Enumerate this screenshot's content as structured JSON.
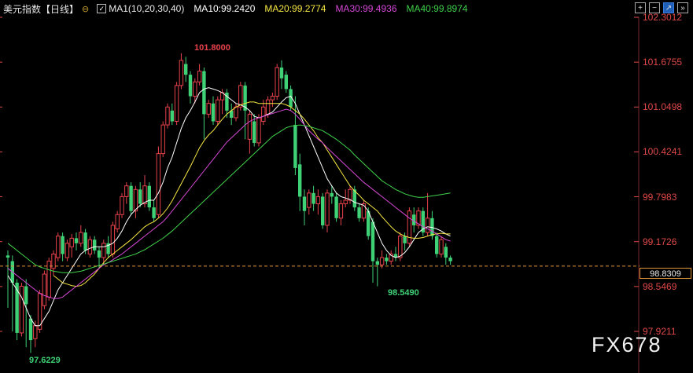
{
  "header": {
    "title": "美元指数",
    "period": "【日线】",
    "toggle_icon": "collapse-toggle-icon",
    "ma_checkbox_label": "MA1(10,20,30,40)",
    "ma": [
      {
        "label": "MA10:99.2420",
        "color": "#ffffff"
      },
      {
        "label": "MA20:99.2774",
        "color": "#f5e642"
      },
      {
        "label": "MA30:99.4936",
        "color": "#d648d6"
      },
      {
        "label": "MA40:99.8974",
        "color": "#3fd14a"
      }
    ],
    "tools": [
      {
        "icon": "add-icon",
        "glyph": "+"
      },
      {
        "icon": "minus-icon",
        "glyph": "−"
      },
      {
        "icon": "draw-icon",
        "glyph": "↗"
      },
      {
        "icon": "collapse-icon",
        "glyph": "»"
      }
    ]
  },
  "colors": {
    "up": "#e8424c",
    "down": "#3fd176",
    "ma10": "#ffffff",
    "ma20": "#f5e642",
    "ma30": "#d648d6",
    "ma40": "#3fd14a",
    "price_line": "#e0953a"
  },
  "price_axis": [
    "102.3012",
    "101.6755",
    "101.0498",
    "100.4241",
    "99.7983",
    "99.1726",
    "98.5469",
    "97.9211"
  ],
  "current_price": "98.8309",
  "annotations": {
    "high": "101.8000",
    "low": "97.6229",
    "recent_low": "98.5490"
  },
  "watermark": "FX678",
  "chart_data": {
    "type": "candlestick",
    "ylim": [
      97.9211,
      102.3012
    ],
    "candles": [
      [
        98.98,
        98.95,
        99.05,
        98.25
      ],
      [
        98.9,
        98.6,
        98.98,
        97.92
      ],
      [
        98.6,
        97.9,
        98.65,
        97.8
      ],
      [
        97.9,
        98.55,
        98.6,
        97.85
      ],
      [
        98.55,
        98.3,
        98.65,
        97.7
      ],
      [
        98.1,
        97.8,
        98.15,
        97.62
      ],
      [
        97.82,
        98.0,
        98.07,
        97.7
      ],
      [
        97.95,
        98.45,
        98.5,
        97.9
      ],
      [
        98.28,
        98.72,
        98.77,
        98.23
      ],
      [
        98.4,
        98.9,
        98.95,
        98.35
      ],
      [
        98.8,
        99.0,
        99.05,
        98.7
      ],
      [
        98.95,
        99.25,
        99.3,
        98.9
      ],
      [
        99.25,
        99.0,
        99.3,
        98.9
      ],
      [
        98.95,
        99.15,
        99.2,
        98.9
      ],
      [
        99.1,
        99.22,
        99.28,
        98.95
      ],
      [
        99.22,
        99.15,
        99.3,
        99.05
      ],
      [
        99.15,
        99.3,
        99.4,
        99.1
      ],
      [
        99.3,
        99.05,
        99.35,
        99.0
      ],
      [
        99.0,
        99.2,
        99.25,
        98.95
      ],
      [
        99.2,
        99.05,
        99.25,
        99.0
      ],
      [
        99.05,
        98.95,
        99.1,
        98.8
      ],
      [
        98.95,
        99.15,
        99.2,
        98.85
      ],
      [
        99.15,
        99.0,
        99.25,
        98.95
      ],
      [
        99.0,
        99.4,
        99.45,
        98.95
      ],
      [
        99.35,
        99.55,
        99.6,
        99.3
      ],
      [
        99.55,
        99.8,
        99.85,
        99.5
      ],
      [
        99.8,
        99.95,
        100.0,
        99.7
      ],
      [
        99.95,
        99.6,
        100.0,
        99.55
      ],
      [
        99.6,
        99.9,
        99.95,
        99.5
      ],
      [
        99.9,
        99.7,
        100.0,
        99.65
      ],
      [
        99.7,
        99.95,
        100.1,
        99.65
      ],
      [
        99.95,
        99.65,
        100.0,
        99.6
      ],
      [
        99.65,
        99.5,
        99.75,
        99.45
      ],
      [
        99.55,
        100.4,
        100.5,
        99.5
      ],
      [
        100.4,
        100.8,
        100.85,
        100.35
      ],
      [
        100.8,
        101.05,
        101.1,
        100.75
      ],
      [
        101.0,
        100.85,
        101.1,
        100.8
      ],
      [
        100.85,
        101.35,
        101.4,
        100.8
      ],
      [
        101.35,
        101.7,
        101.8,
        101.3
      ],
      [
        101.65,
        101.5,
        101.75,
        101.4
      ],
      [
        101.5,
        101.2,
        101.55,
        101.1
      ],
      [
        101.2,
        101.4,
        101.45,
        101.1
      ],
      [
        101.4,
        101.55,
        101.65,
        101.35
      ],
      [
        101.55,
        100.95,
        101.6,
        100.6
      ],
      [
        100.95,
        101.1,
        101.15,
        100.9
      ],
      [
        101.1,
        100.85,
        101.2,
        100.8
      ],
      [
        100.85,
        101.15,
        101.2,
        100.8
      ],
      [
        101.15,
        101.25,
        101.3,
        100.95
      ],
      [
        101.25,
        101.0,
        101.3,
        100.9
      ],
      [
        101.0,
        100.9,
        101.1,
        100.8
      ],
      [
        100.9,
        101.05,
        101.1,
        100.85
      ],
      [
        101.05,
        101.35,
        101.4,
        101.0
      ],
      [
        101.35,
        101.0,
        101.4,
        100.6
      ],
      [
        100.6,
        100.95,
        101.0,
        100.4
      ],
      [
        100.85,
        100.55,
        100.95,
        100.5
      ],
      [
        100.55,
        100.9,
        100.95,
        100.5
      ],
      [
        100.85,
        101.05,
        101.15,
        100.8
      ],
      [
        100.95,
        101.15,
        101.2,
        100.9
      ],
      [
        101.15,
        101.2,
        101.25,
        101.05
      ],
      [
        101.2,
        101.6,
        101.65,
        101.15
      ],
      [
        101.6,
        101.45,
        101.7,
        101.3
      ],
      [
        101.5,
        101.3,
        101.55,
        101.25
      ],
      [
        101.3,
        101.05,
        101.35,
        101.0
      ],
      [
        100.8,
        100.2,
        101.2,
        100.1
      ],
      [
        100.25,
        99.8,
        100.4,
        99.6
      ],
      [
        99.8,
        99.6,
        99.9,
        99.4
      ],
      [
        99.65,
        99.85,
        99.9,
        99.55
      ],
      [
        99.85,
        99.7,
        99.95,
        99.6
      ],
      [
        99.7,
        99.8,
        99.9,
        99.55
      ],
      [
        99.8,
        99.4,
        99.85,
        99.35
      ],
      [
        99.4,
        99.85,
        99.9,
        99.3
      ],
      [
        99.85,
        99.8,
        99.95,
        99.7
      ],
      [
        99.8,
        99.5,
        99.85,
        99.45
      ],
      [
        99.5,
        99.7,
        99.75,
        99.4
      ],
      [
        99.7,
        99.75,
        99.9,
        99.65
      ],
      [
        99.75,
        99.9,
        99.95,
        99.7
      ],
      [
        99.9,
        99.65,
        99.95,
        99.6
      ],
      [
        99.65,
        99.5,
        99.7,
        99.45
      ],
      [
        99.5,
        99.7,
        99.75,
        99.45
      ],
      [
        99.6,
        99.25,
        99.65,
        99.2
      ],
      [
        99.45,
        98.9,
        99.5,
        98.6
      ],
      [
        98.9,
        98.85,
        98.95,
        98.55
      ],
      [
        98.85,
        98.95,
        99.05,
        98.8
      ],
      [
        98.95,
        98.9,
        99.0,
        98.85
      ],
      [
        98.9,
        99.0,
        99.05,
        98.85
      ],
      [
        99.0,
        98.95,
        99.1,
        98.9
      ],
      [
        98.95,
        99.25,
        99.3,
        98.9
      ],
      [
        99.25,
        99.15,
        99.3,
        99.05
      ],
      [
        99.15,
        99.6,
        99.65,
        99.1
      ],
      [
        99.55,
        99.4,
        99.65,
        99.3
      ],
      [
        99.4,
        99.6,
        99.65,
        99.35
      ],
      [
        99.6,
        99.3,
        99.65,
        99.25
      ],
      [
        99.3,
        99.5,
        99.85,
        99.25
      ],
      [
        99.5,
        99.25,
        99.6,
        99.2
      ],
      [
        99.25,
        99.0,
        99.3,
        98.95
      ],
      [
        99.0,
        99.2,
        99.25,
        98.95
      ],
      [
        99.1,
        98.95,
        99.15,
        98.85
      ],
      [
        98.95,
        98.9,
        98.98,
        98.85
      ]
    ],
    "series": [
      {
        "name": "MA10",
        "values": [
          98.7,
          98.6,
          98.5,
          98.4,
          98.25,
          98.1,
          98.0,
          98.0,
          98.1,
          98.2,
          98.35,
          98.5,
          98.6,
          98.7,
          98.8,
          98.9,
          99.0,
          99.05,
          99.08,
          99.1,
          99.1,
          99.1,
          99.12,
          99.15,
          99.22,
          99.32,
          99.45,
          99.55,
          99.62,
          99.68,
          99.72,
          99.75,
          99.75,
          99.85,
          100.0,
          100.2,
          100.35,
          100.55,
          100.75,
          100.9,
          101.0,
          101.12,
          101.25,
          101.3,
          101.32,
          101.3,
          101.28,
          101.25,
          101.2,
          101.15,
          101.1,
          101.08,
          101.05,
          101.0,
          100.92,
          100.9,
          100.92,
          100.95,
          100.98,
          101.05,
          101.12,
          101.18,
          101.2,
          101.1,
          100.95,
          100.8,
          100.65,
          100.5,
          100.35,
          100.2,
          100.05,
          99.95,
          99.85,
          99.8,
          99.78,
          99.76,
          99.72,
          99.7,
          99.68,
          99.6,
          99.45,
          99.3,
          99.15,
          99.05,
          98.98,
          98.95,
          98.97,
          99.02,
          99.1,
          99.2,
          99.3,
          99.35,
          99.38,
          99.37,
          99.35,
          99.32,
          99.28,
          99.25
        ]
      },
      {
        "name": "MA20",
        "values": [
          null,
          null,
          null,
          null,
          null,
          null,
          null,
          null,
          null,
          null,
          98.7,
          98.65,
          98.6,
          98.58,
          98.56,
          98.55,
          98.56,
          98.6,
          98.66,
          98.72,
          98.8,
          98.88,
          98.95,
          99.0,
          99.05,
          99.1,
          99.15,
          99.2,
          99.26,
          99.32,
          99.38,
          99.42,
          99.45,
          99.5,
          99.56,
          99.64,
          99.74,
          99.86,
          99.98,
          100.1,
          100.22,
          100.35,
          100.48,
          100.58,
          100.66,
          100.72,
          100.8,
          100.88,
          100.95,
          101.0,
          101.05,
          101.08,
          101.1,
          101.12,
          101.12,
          101.1,
          101.1,
          101.1,
          101.1,
          101.1,
          101.1,
          101.08,
          101.05,
          101.0,
          100.95,
          100.88,
          100.8,
          100.72,
          100.62,
          100.55,
          100.45,
          100.35,
          100.25,
          100.15,
          100.05,
          99.95,
          99.88,
          99.82,
          99.75,
          99.7,
          99.65,
          99.6,
          99.52,
          99.45,
          99.38,
          99.32,
          99.28,
          99.25,
          99.23,
          99.22,
          99.22,
          99.23,
          99.25,
          99.27,
          99.28,
          99.29,
          99.28,
          99.28
        ]
      },
      {
        "name": "MA30",
        "values": [
          98.8,
          98.75,
          98.7,
          98.65,
          98.6,
          98.55,
          98.5,
          98.45,
          98.42,
          98.4,
          98.38,
          98.38,
          98.4,
          98.45,
          98.5,
          98.55,
          98.6,
          98.65,
          98.7,
          98.75,
          98.8,
          98.85,
          98.88,
          98.92,
          98.96,
          99.0,
          99.05,
          99.1,
          99.15,
          99.2,
          99.25,
          99.3,
          99.35,
          99.4,
          99.45,
          99.52,
          99.6,
          99.68,
          99.76,
          99.84,
          99.92,
          100.0,
          100.08,
          100.16,
          100.24,
          100.32,
          100.4,
          100.48,
          100.56,
          100.62,
          100.68,
          100.74,
          100.8,
          100.85,
          100.88,
          100.9,
          100.92,
          100.94,
          100.96,
          100.98,
          101.0,
          101.02,
          101.0,
          100.95,
          100.88,
          100.8,
          100.72,
          100.66,
          100.6,
          100.55,
          100.48,
          100.42,
          100.36,
          100.3,
          100.24,
          100.18,
          100.12,
          100.06,
          100.0,
          99.95,
          99.9,
          99.85,
          99.8,
          99.75,
          99.7,
          99.65,
          99.6,
          99.55,
          99.5,
          99.46,
          99.42,
          99.38,
          99.35,
          99.32,
          99.28,
          99.24,
          99.2,
          99.18
        ]
      },
      {
        "name": "MA40",
        "values": [
          99.15,
          99.1,
          99.05,
          99.0,
          98.95,
          98.9,
          98.85,
          98.82,
          98.8,
          98.78,
          98.76,
          98.75,
          98.74,
          98.74,
          98.74,
          98.75,
          98.76,
          98.78,
          98.8,
          98.82,
          98.84,
          98.86,
          98.88,
          98.9,
          98.92,
          98.94,
          98.96,
          98.98,
          99.0,
          99.03,
          99.06,
          99.1,
          99.14,
          99.18,
          99.22,
          99.27,
          99.32,
          99.38,
          99.44,
          99.5,
          99.56,
          99.62,
          99.68,
          99.74,
          99.8,
          99.86,
          99.92,
          99.98,
          100.04,
          100.1,
          100.16,
          100.22,
          100.28,
          100.34,
          100.4,
          100.46,
          100.52,
          100.58,
          100.64,
          100.68,
          100.72,
          100.76,
          100.78,
          100.79,
          100.8,
          100.79,
          100.78,
          100.76,
          100.74,
          100.72,
          100.68,
          100.64,
          100.6,
          100.55,
          100.5,
          100.45,
          100.38,
          100.32,
          100.26,
          100.2,
          100.14,
          100.08,
          100.02,
          99.98,
          99.94,
          99.9,
          99.87,
          99.84,
          99.82,
          99.8,
          99.79,
          99.79,
          99.8,
          99.81,
          99.82,
          99.83,
          99.84,
          99.85
        ]
      }
    ]
  }
}
